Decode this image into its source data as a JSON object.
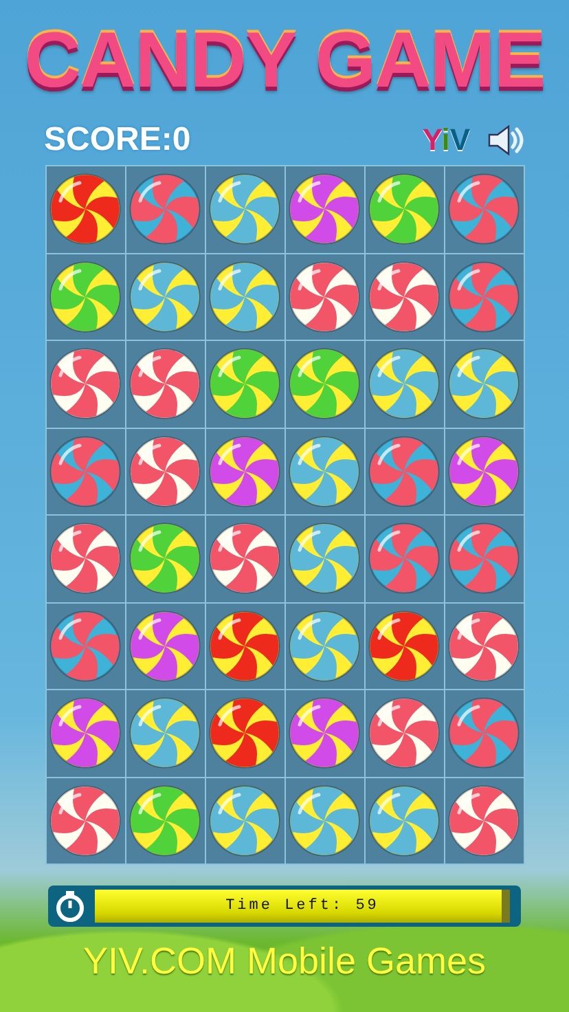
{
  "title": "CANDY GAME",
  "score": {
    "label": "SCORE:",
    "value": "0"
  },
  "logo": "YiV",
  "board": [
    [
      {
        "kind": "red"
      },
      {
        "kind": "blue"
      },
      {
        "kind": "cyan"
      },
      {
        "kind": "purple"
      },
      {
        "kind": "green"
      },
      {
        "kind": "blue"
      }
    ],
    [
      {
        "kind": "green"
      },
      {
        "kind": "cyan"
      },
      {
        "kind": "cyan"
      },
      {
        "kind": "white"
      },
      {
        "kind": "white"
      },
      {
        "kind": "blue"
      }
    ],
    [
      {
        "kind": "white"
      },
      {
        "kind": "white"
      },
      {
        "kind": "green"
      },
      {
        "kind": "green"
      },
      {
        "kind": "cyan"
      },
      {
        "kind": "cyan"
      }
    ],
    [
      {
        "kind": "blue"
      },
      {
        "kind": "white"
      },
      {
        "kind": "purple"
      },
      {
        "kind": "cyan"
      },
      {
        "kind": "blue"
      },
      {
        "kind": "purple"
      }
    ],
    [
      {
        "kind": "white"
      },
      {
        "kind": "green"
      },
      {
        "kind": "white"
      },
      {
        "kind": "cyan"
      },
      {
        "kind": "blue"
      },
      {
        "kind": "blue"
      }
    ],
    [
      {
        "kind": "blue"
      },
      {
        "kind": "purple"
      },
      {
        "kind": "red"
      },
      {
        "kind": "cyan"
      },
      {
        "kind": "red"
      },
      {
        "kind": "white"
      }
    ],
    [
      {
        "kind": "purple"
      },
      {
        "kind": "cyan"
      },
      {
        "kind": "red"
      },
      {
        "kind": "purple"
      },
      {
        "kind": "white"
      },
      {
        "kind": "blue"
      }
    ],
    [
      {
        "kind": "white"
      },
      {
        "kind": "green"
      },
      {
        "kind": "cyan"
      },
      {
        "kind": "cyan"
      },
      {
        "kind": "cyan"
      },
      {
        "kind": "white"
      }
    ]
  ],
  "timer": {
    "label": "Time Left: 59",
    "level": 0.98
  },
  "footer": "YIV.COM Mobile Games"
}
